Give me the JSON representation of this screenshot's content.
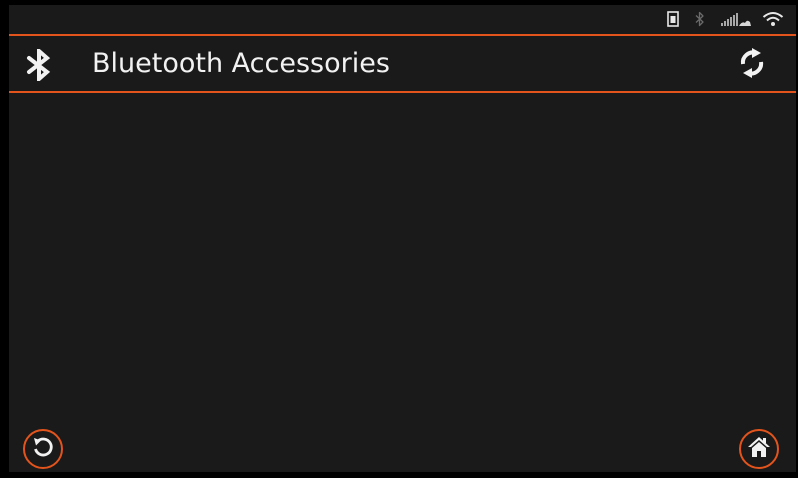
{
  "header": {
    "title": "Bluetooth Accessories",
    "icon": "bluetooth-icon",
    "refresh_icon": "refresh-icon"
  },
  "status_bar": {
    "icons": [
      "battery-icon",
      "bluetooth-icon",
      "cellular-signal-icon",
      "wifi-icon"
    ]
  },
  "footer": {
    "back_icon": "back-icon",
    "home_icon": "home-icon"
  },
  "colors": {
    "accent": "#e3541d",
    "background": "#1a1a1a",
    "text": "#f2f2f2"
  }
}
